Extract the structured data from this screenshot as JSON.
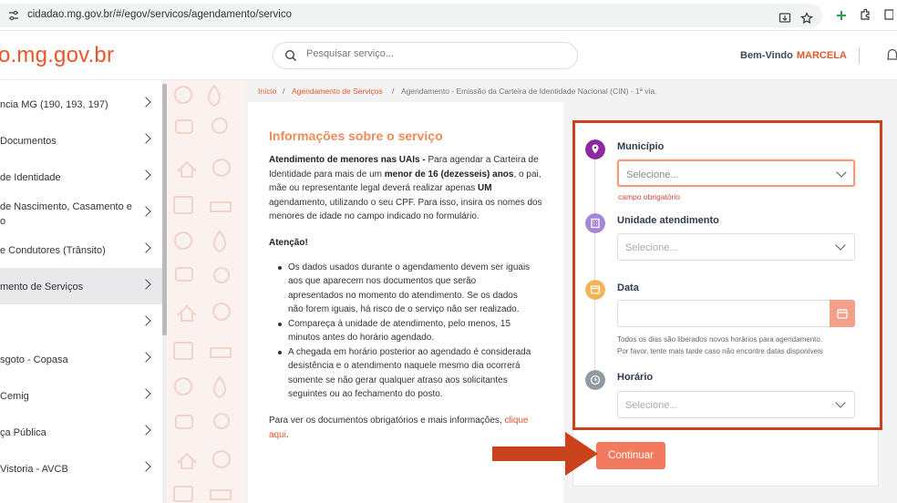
{
  "browser": {
    "url": "cidadao.mg.gov.br/#/egov/servicos/agendamento/servico"
  },
  "header": {
    "logo": "o.mg.gov.br",
    "search_placeholder": "Pesquisar serviço...",
    "welcome": "Bem-Vindo",
    "user": "MARCELA"
  },
  "sidebar": {
    "items": [
      {
        "label": "ncia MG (190, 193, 197)"
      },
      {
        "label": "Documentos"
      },
      {
        "label": "de Identidade"
      },
      {
        "label": "de Nascimento, Casamento e",
        "label2": "o"
      },
      {
        "label": "e Condutores (Trânsito)"
      },
      {
        "label": "mento de Serviços"
      },
      {
        "label": ""
      },
      {
        "label": "sgoto - Copasa"
      },
      {
        "label": "Cemig"
      },
      {
        "label": "ça Pública"
      },
      {
        "label": "Vistoria - AVCB"
      }
    ]
  },
  "breadcrumb": {
    "home": "Início",
    "sep": "/",
    "section": "Agendamento de Serviços",
    "current": "Agendamento - Emissão da Carteira de Identidade Nacional (CIN) - 1ª via."
  },
  "info": {
    "title": "Informações sobre o serviço",
    "p1_lines": [
      {
        "pre_bold": "Atendimento de menores nas UAIs -",
        "text": " Para agendar a Carteira de"
      },
      {
        "text": "Identidade para mais de um ",
        "bold": "menor de 16 (dezesseis) anos",
        "post": ", o pai,"
      },
      {
        "text": "mãe ou representante legal deverá realizar apenas ",
        "bold": "UM"
      },
      {
        "text": "agendamento, utilizando o seu CPF. Para isso, insira os nomes dos"
      },
      {
        "text": "menores de idade no campo indicado no formulário."
      }
    ],
    "attention": "Atenção!",
    "bullets": [
      [
        "Os dados usados durante o agendamento devem ser iguais",
        "aos que aparecem nos documentos que serão",
        "apresentados no momento do atendimento. Se os dados",
        "não forem iguais, há risco de o serviço não ser realizado."
      ],
      [
        "Compareça à unidade de atendimento, pelo menos, 15",
        "minutos antes do horário agendado."
      ],
      [
        "A chegada em horário posterior ao agendado é considerada",
        "desistência e o atendimento naquele mesmo dia ocorrerá",
        "somente se não gerar qualquer atraso aos solicitantes",
        "seguintes ou ao fechamento do posto."
      ]
    ],
    "more_text": "Para ver os documentos obrigatórios e mais informações, ",
    "more_link1": "clique",
    "more_link2": "aqui",
    "more_end": "."
  },
  "form": {
    "municipio_label": "Município",
    "municipio_value": "Selecione...",
    "municipio_error": "campo obrigatório",
    "unidade_label": "Unidade atendimento",
    "unidade_value": "Selecione...",
    "data_label": "Data",
    "data_hint1": "Todos os dias são liberados novos horários para agendamento.",
    "data_hint2": "Por favor, tente mais tarde caso não encontre datas disponíveis",
    "horario_label": "Horário",
    "horario_value": "Selecione...",
    "submit": "Continuar"
  },
  "colors": {
    "brand": "#e8562a",
    "highlight_border": "#c9421c",
    "step_municipio": "#8e2aa0",
    "step_unidade": "#a587d6",
    "step_data": "#f2b457",
    "step_horario": "#8f9aa3",
    "button": "#f37a5e"
  },
  "icons": [
    "tune-icon",
    "install-icon",
    "star-icon",
    "extension-icon",
    "puzzle-icon",
    "search-icon",
    "bell-icon",
    "location-pin-icon",
    "building-icon",
    "calendar-icon",
    "clock-icon",
    "arrow-right-icon"
  ]
}
